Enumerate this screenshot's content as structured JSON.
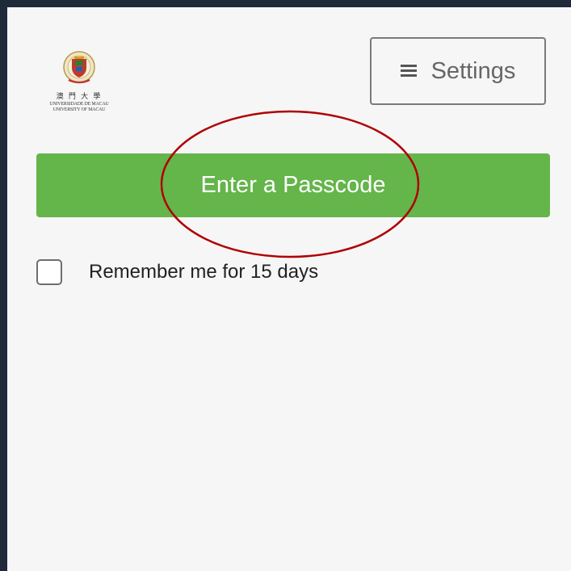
{
  "header": {
    "logo": {
      "chinese_name": "澳 門 大 學",
      "portuguese_name": "UNIVERSIDADE DE MACAU",
      "english_name": "UNIVERSITY OF MACAU"
    },
    "settings_button": {
      "icon": "menu-icon",
      "label": "Settings"
    }
  },
  "main": {
    "passcode_button": {
      "label": "Enter a Passcode",
      "color": "#64b54a"
    },
    "remember_me": {
      "label": "Remember me for 15 days",
      "checked": false
    }
  },
  "annotation": {
    "shape": "ellipse",
    "color": "#b00000"
  }
}
